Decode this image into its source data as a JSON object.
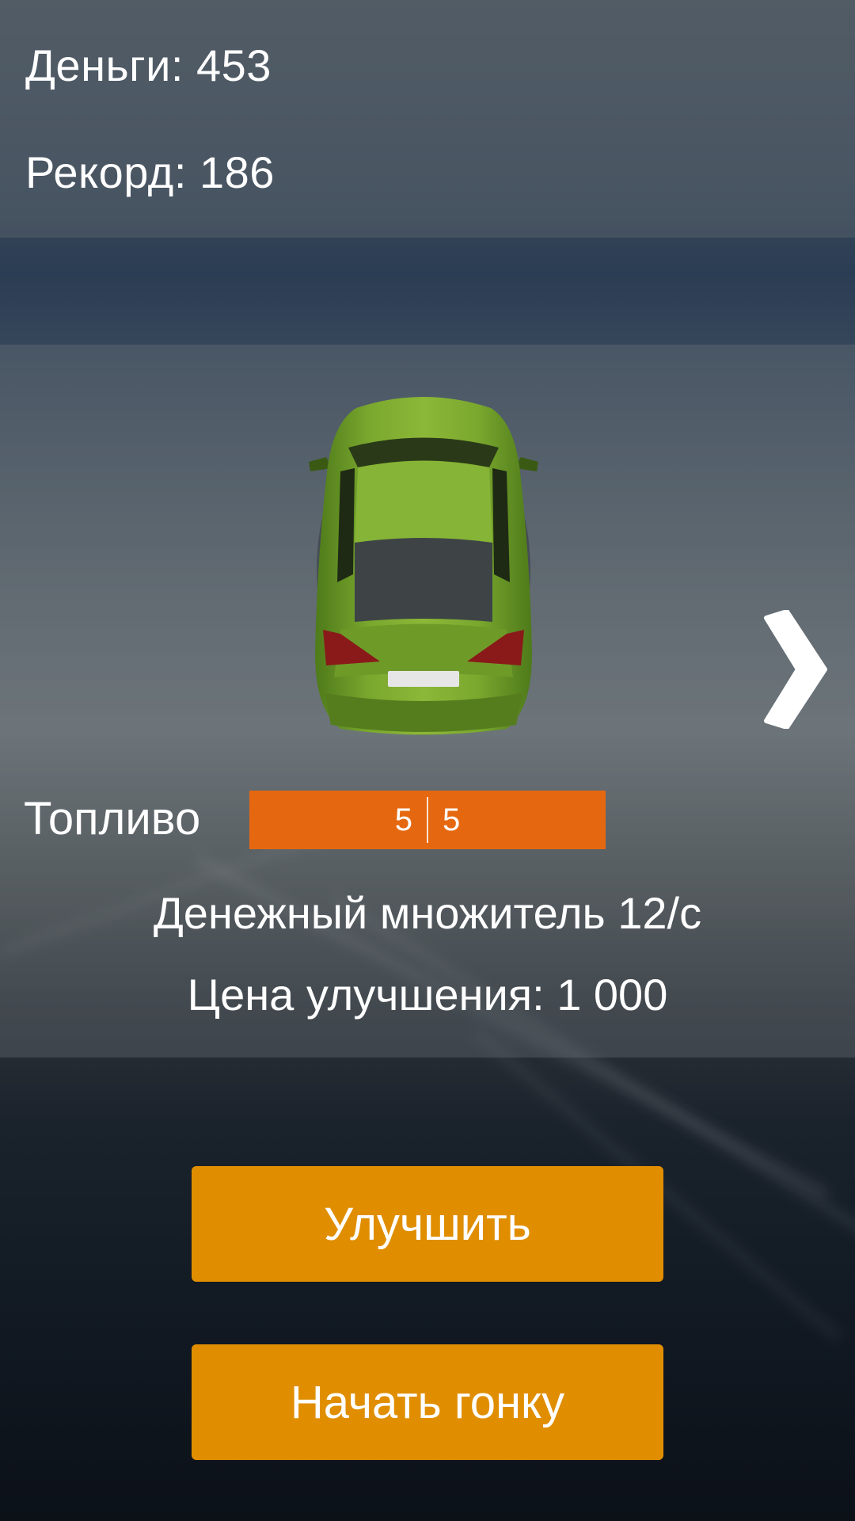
{
  "stats": {
    "money": "Деньги: 453",
    "record": "Рекорд: 186"
  },
  "car": {
    "image": "car-top-view",
    "color": "#6d9a2a"
  },
  "navigation": {
    "next_icon": "chevron-right-icon"
  },
  "fuel": {
    "label": "Топливо",
    "current": "5",
    "max": "5",
    "bar_color": "#e56810"
  },
  "info": {
    "multiplier": "Денежный множитель  12/с",
    "upgrade_price": "Цена улучшения: 1 000"
  },
  "buttons": {
    "upgrade": "Улучшить",
    "start_race": "Начать гонку",
    "color": "#e08e00"
  }
}
